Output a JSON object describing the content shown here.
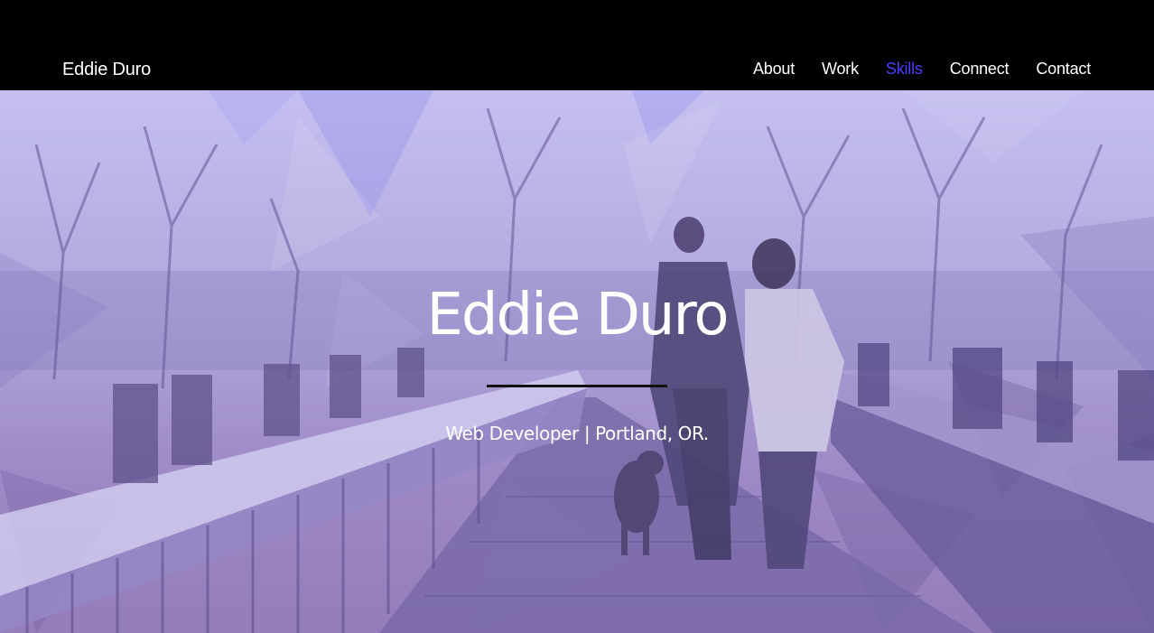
{
  "navbar": {
    "brand": "Eddie Duro",
    "links": [
      {
        "label": "About"
      },
      {
        "label": "Work"
      },
      {
        "label": "Skills",
        "active": true
      },
      {
        "label": "Connect"
      },
      {
        "label": "Contact"
      }
    ]
  },
  "hero": {
    "title": "Eddie Duro",
    "subtitle": "Web Developer | Portland, OR.",
    "background_image": "photo of a couple and a dog walking on a wooden bridge among bare trees, purple low-poly overlay"
  },
  "colors": {
    "nav_background": "#000000",
    "nav_text": "#ffffff",
    "nav_active": "#4a3dff",
    "overlay_tint": "#b0a4e0"
  }
}
